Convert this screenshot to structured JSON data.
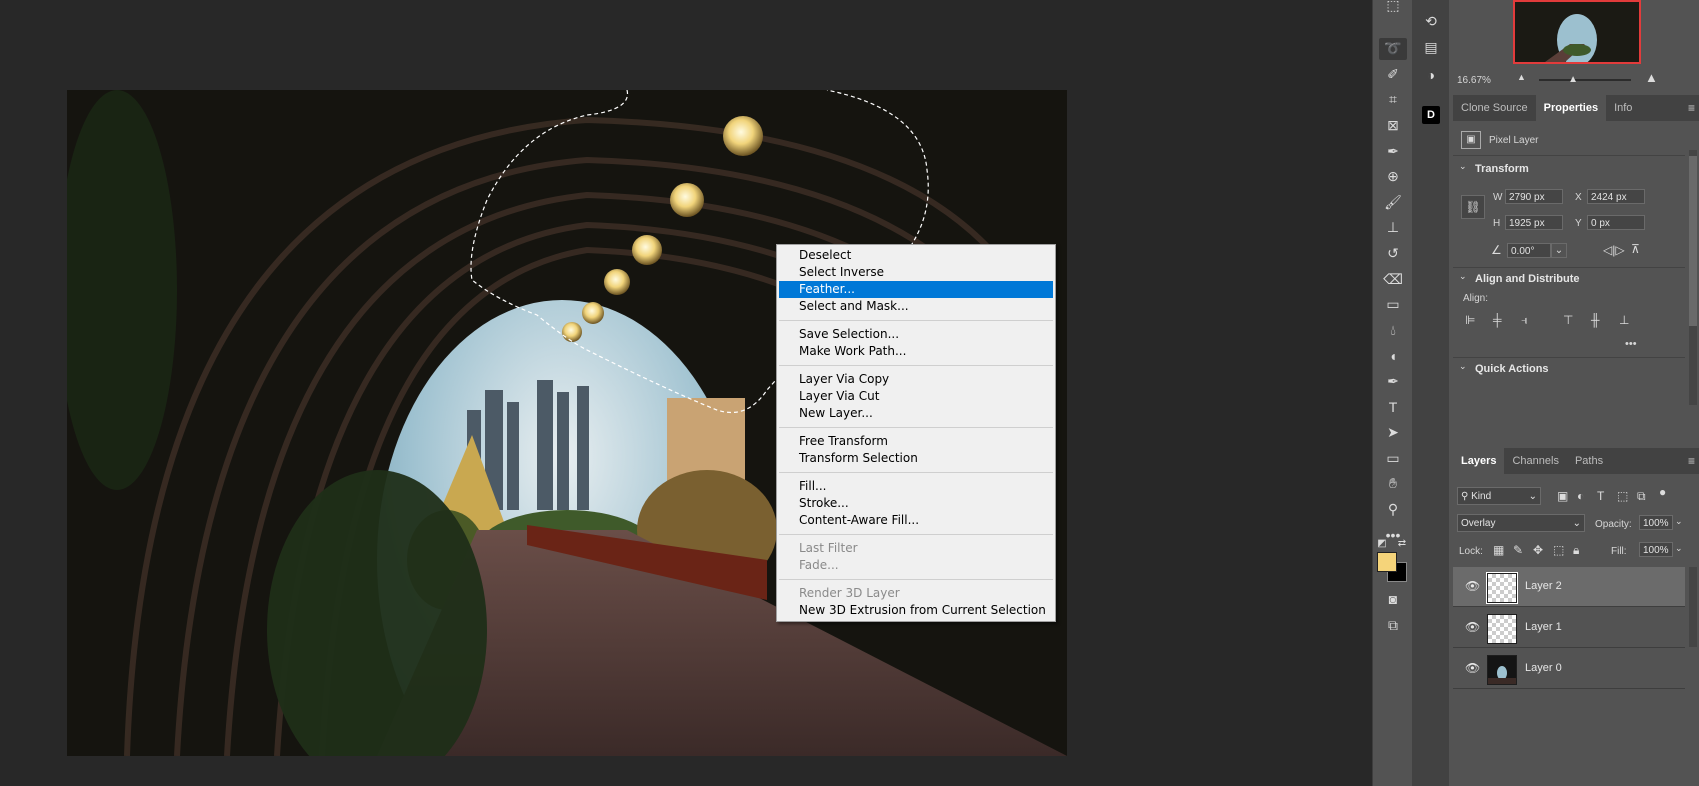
{
  "context_menu": {
    "groups": [
      [
        {
          "label": "Deselect",
          "state": "normal"
        },
        {
          "label": "Select Inverse",
          "state": "normal"
        },
        {
          "label": "Feather...",
          "state": "highlighted"
        },
        {
          "label": "Select and Mask...",
          "state": "normal"
        }
      ],
      [
        {
          "label": "Save Selection...",
          "state": "normal"
        },
        {
          "label": "Make Work Path...",
          "state": "normal"
        }
      ],
      [
        {
          "label": "Layer Via Copy",
          "state": "normal"
        },
        {
          "label": "Layer Via Cut",
          "state": "normal"
        },
        {
          "label": "New Layer...",
          "state": "normal"
        }
      ],
      [
        {
          "label": "Free Transform",
          "state": "normal"
        },
        {
          "label": "Transform Selection",
          "state": "normal"
        }
      ],
      [
        {
          "label": "Fill...",
          "state": "normal"
        },
        {
          "label": "Stroke...",
          "state": "normal"
        },
        {
          "label": "Content-Aware Fill...",
          "state": "normal"
        }
      ],
      [
        {
          "label": "Last Filter",
          "state": "disabled"
        },
        {
          "label": "Fade...",
          "state": "disabled"
        }
      ],
      [
        {
          "label": "Render 3D Layer",
          "state": "disabled"
        },
        {
          "label": "New 3D Extrusion from Current Selection",
          "state": "normal"
        }
      ]
    ]
  },
  "navigator": {
    "zoom": "16.67%",
    "zoom_slider_fraction": 0.36
  },
  "properties_panel": {
    "tabs": [
      "Clone Source",
      "Properties",
      "Info"
    ],
    "active_tab": "Properties",
    "layer_kind": "Pixel Layer",
    "transform": {
      "title": "Transform",
      "w_label": "W",
      "w": "2790 px",
      "h_label": "H",
      "h": "1925 px",
      "x_label": "X",
      "x": "2424 px",
      "y_label": "Y",
      "y": "0 px",
      "angle": "0.00°"
    },
    "align": {
      "title": "Align and Distribute",
      "align_label": "Align:",
      "more": "•••"
    },
    "quick_actions": {
      "title": "Quick Actions"
    }
  },
  "layers_panel": {
    "tabs": [
      "Layers",
      "Channels",
      "Paths"
    ],
    "active_tab": "Layers",
    "filter_kind": "Kind",
    "blend_mode": "Overlay",
    "opacity_label": "Opacity:",
    "opacity": "100%",
    "lock_label": "Lock:",
    "fill_label": "Fill:",
    "fill": "100%",
    "layers": [
      {
        "name": "Layer 2",
        "selected": true,
        "visible": true,
        "type": "transparent"
      },
      {
        "name": "Layer 1",
        "selected": false,
        "visible": true,
        "type": "transparent"
      },
      {
        "name": "Layer 0",
        "selected": false,
        "visible": true,
        "type": "photo"
      }
    ]
  },
  "colors": {
    "foreground": "#f5d47a",
    "background": "#000000",
    "highlight": "#0078d7",
    "navigator_frame": "#e23b3b"
  },
  "tools": [
    "move-icon",
    "lasso-icon",
    "quick-selection-icon",
    "crop-icon",
    "frame-icon",
    "eyedropper-icon",
    "healing-icon",
    "brush-icon",
    "stamp-icon",
    "history-brush-icon",
    "eraser-icon",
    "gradient-icon",
    "blur-icon",
    "dodge-icon",
    "pen-icon",
    "type-icon",
    "path-select-icon",
    "rectangle-icon",
    "hand-icon",
    "zoom-icon",
    "more-tools-icon"
  ]
}
